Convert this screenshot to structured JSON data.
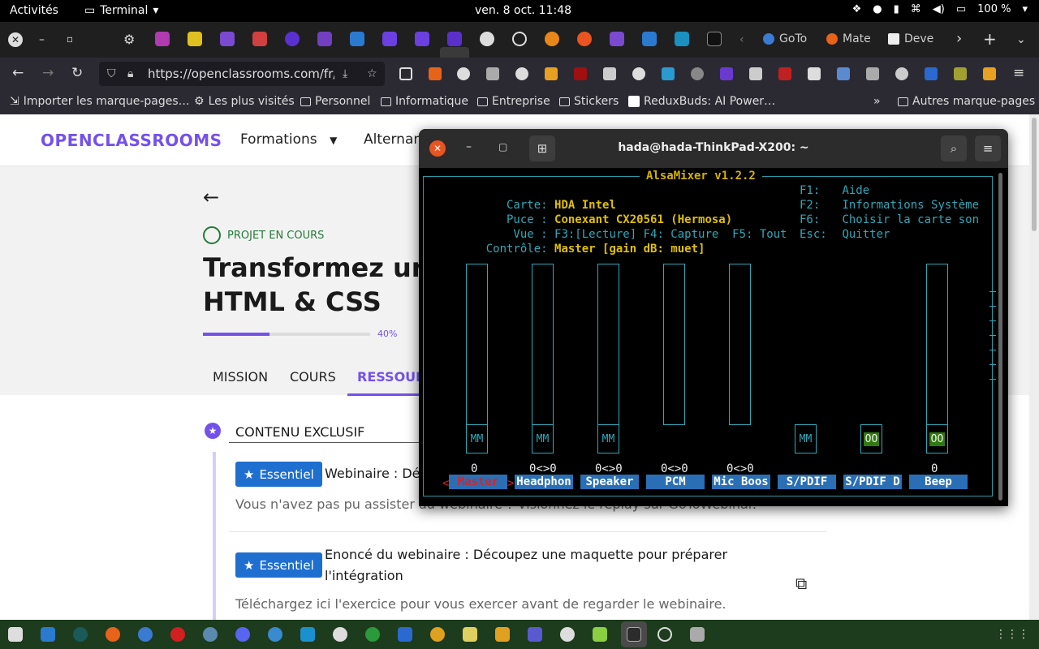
{
  "topbar": {
    "activities": "Activités",
    "app_name": "Terminal",
    "clock": "ven. 8 oct.  11:48",
    "battery": "100 %"
  },
  "tabs": {
    "named": [
      {
        "label": "GoTo",
        "color": "#3a7bd5"
      },
      {
        "label": "Mate",
        "color": "#e8631a"
      },
      {
        "label": "Deve",
        "color": "#eeeeee"
      }
    ]
  },
  "navbar": {
    "url": "https://openclassrooms.com/fr/p"
  },
  "bookmarks": {
    "items": [
      "Importer les marque-pages…",
      "Les plus visités",
      "Personnel",
      "Informatique",
      "Entreprise",
      "Stickers",
      "ReduxBuds: AI Power…"
    ],
    "other": "Autres marque-pages"
  },
  "page": {
    "logo": "OPENCLASSROOMS",
    "nav": [
      "Formations",
      "Alternan"
    ],
    "status": "PROJET EN COURS",
    "title_line1": "Transformez une",
    "title_line2": "HTML & CSS",
    "progress_percent": 40,
    "progress_label": "40%",
    "tabs": [
      "MISSION",
      "COURS",
      "RESSOUR"
    ],
    "section_title": "CONTENU EXCLUSIF",
    "resources": [
      {
        "badge": "Essentiel",
        "title": "Webinaire : Dé",
        "desc": "Vous n'avez pas pu assister au webinaire ? Visionnez le replay sur GoToWebinar."
      },
      {
        "badge": "Essentiel",
        "title_line1": "Enoncé du webinaire : Découpez une maquette pour préparer",
        "title_line2": "l'intégration",
        "desc": "Téléchargez ici l'exercice pour vous exercer avant de regarder le webinaire."
      }
    ]
  },
  "terminal": {
    "title": "hada@hada-ThinkPad-X200: ~",
    "alsamixer": {
      "header": "AlsaMixer v1.2.2",
      "info": [
        {
          "key": "Carte:",
          "value": "HDA Intel"
        },
        {
          "key": "Puce :",
          "value": "Conexant CX20561 (Hermosa)"
        },
        {
          "key": "Vue :",
          "value": "F3:[Lecture] F4: Capture  F5: Tout"
        },
        {
          "key": "Contrôle:",
          "value": "Master [gain dB: muet]"
        }
      ],
      "help": [
        {
          "key": "F1:",
          "value": "Aide"
        },
        {
          "key": "F2:",
          "value": "Informations Système"
        },
        {
          "key": "F6:",
          "value": "Choisir la carte son"
        },
        {
          "key": "Esc:",
          "value": "Quitter"
        }
      ],
      "controls": [
        {
          "name": "Master",
          "value": "0",
          "foot": "MM",
          "selected": true
        },
        {
          "name": "Headphon",
          "value": "0<>0",
          "foot": "MM"
        },
        {
          "name": "Speaker",
          "value": "0<>0",
          "foot": "MM"
        },
        {
          "name": "PCM",
          "value": "0<>0",
          "foot": ""
        },
        {
          "name": "Mic Boos",
          "value": "0<>0",
          "foot": ""
        },
        {
          "name": "S/PDIF",
          "value": "",
          "foot": "MM"
        },
        {
          "name": "S/PDIF D",
          "value": "",
          "foot": "OO"
        },
        {
          "name": "Beep",
          "value": "0",
          "foot": "OO"
        }
      ]
    }
  },
  "colors": {
    "brand": "#7451eb",
    "badge": "#1f6fd0",
    "terminal_accent": "#2fa8b8",
    "ubuntu_orange": "#e95420"
  }
}
